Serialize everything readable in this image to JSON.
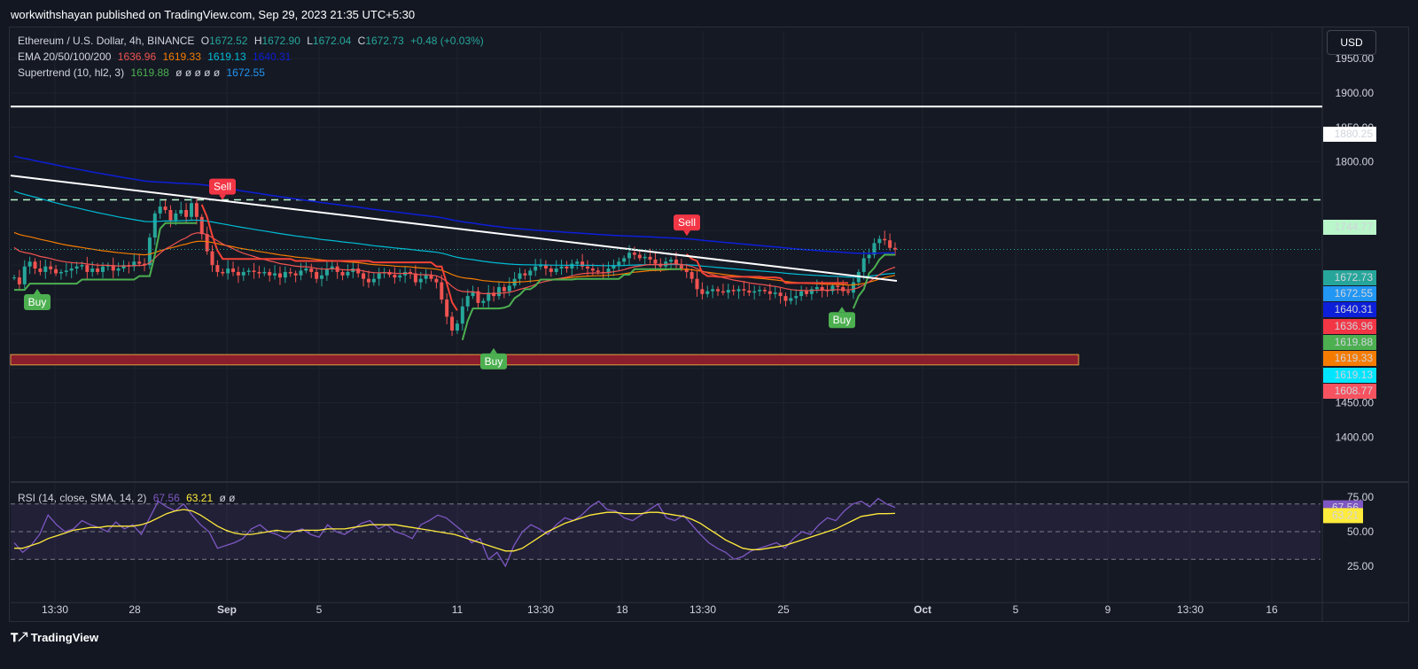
{
  "header": {
    "published": "workwithshayan published on TradingView.com, Sep 29, 2023 21:35 UTC+5:30"
  },
  "legend": {
    "symbol": "Ethereum / U.S. Dollar, 4h, BINANCE",
    "open_label": "O",
    "open": "1672.52",
    "high_label": "H",
    "high": "1672.90",
    "low_label": "L",
    "low": "1672.04",
    "close_label": "C",
    "close": "1672.73",
    "change": "+0.48 (+0.03%)",
    "ema_label": "EMA 20/50/100/200",
    "ema20": "1636.96",
    "ema50": "1619.33",
    "ema100": "1619.13",
    "ema200": "1640.31",
    "supertrend_label": "Supertrend (10, hl2, 3)",
    "st_value": "1619.88",
    "st_empty": "ø ø ø ø ø",
    "st_value2": "1672.55",
    "rsi_label": "RSI (14, close, SMA, 14, 2)",
    "rsi_value": "67.56",
    "rsi_ma": "63.21",
    "rsi_empty": "ø ø"
  },
  "currency_button": "USD",
  "footer": {
    "brand": "TradingView"
  },
  "colors": {
    "up": "#26a69a",
    "down": "#ef5350",
    "ema20": "#ef5350",
    "ema50": "#f57c00",
    "ema100": "#00bcd4",
    "ema200": "#0d1fd8",
    "supertrend_up": "#4caf50",
    "supertrend_down": "#f44336",
    "rsi": "#7e57c2",
    "rsi_ma": "#ffeb3b"
  },
  "chart_data": [
    {
      "type": "candlestick",
      "name": "ETHUSD 4h",
      "x_ticks": [
        "13:30",
        "28",
        "Sep",
        "5",
        "11",
        "13:30",
        "18",
        "13:30",
        "25",
        "Oct",
        "5",
        "9",
        "13:30",
        "16"
      ],
      "y_ticks": [
        "1950.00",
        "1900.00",
        "1850.00",
        "1800.00",
        "1700.00",
        "1450.00",
        "1400.00"
      ],
      "ylim": [
        1370,
        1990
      ],
      "close_path": [
        1632,
        1622,
        1648,
        1655,
        1645,
        1640,
        1648,
        1644,
        1638,
        1640,
        1642,
        1645,
        1648,
        1650,
        1640,
        1645,
        1640,
        1648,
        1650,
        1642,
        1645,
        1650,
        1648,
        1655,
        1652,
        1650,
        1690,
        1725,
        1735,
        1730,
        1715,
        1725,
        1730,
        1720,
        1740,
        1720,
        1695,
        1670,
        1650,
        1640,
        1638,
        1645,
        1640,
        1635,
        1640,
        1642,
        1640,
        1638,
        1640,
        1635,
        1638,
        1632,
        1640,
        1638,
        1635,
        1642,
        1645,
        1640,
        1630,
        1635,
        1645,
        1648,
        1640,
        1635,
        1640,
        1645,
        1638,
        1630,
        1625,
        1630,
        1638,
        1640,
        1636,
        1632,
        1635,
        1640,
        1638,
        1625,
        1630,
        1636,
        1630,
        1625,
        1600,
        1575,
        1555,
        1565,
        1590,
        1605,
        1612,
        1595,
        1598,
        1610,
        1605,
        1618,
        1612,
        1620,
        1630,
        1638,
        1635,
        1642,
        1648,
        1650,
        1645,
        1640,
        1645,
        1648,
        1645,
        1652,
        1655,
        1648,
        1645,
        1642,
        1640,
        1638,
        1645,
        1650,
        1655,
        1660,
        1668,
        1665,
        1660,
        1662,
        1658,
        1652,
        1648,
        1655,
        1658,
        1650,
        1645,
        1640,
        1630,
        1615,
        1608,
        1612,
        1615,
        1612,
        1610,
        1614,
        1612,
        1615,
        1613,
        1610,
        1612,
        1614,
        1612,
        1608,
        1610,
        1605,
        1598,
        1602,
        1605,
        1612,
        1608,
        1615,
        1618,
        1614,
        1612,
        1620,
        1618,
        1612,
        1610,
        1625,
        1640,
        1660,
        1665,
        1682,
        1688,
        1686,
        1675,
        1672.73
      ],
      "horizontal_levels": [
        {
          "price": "1880.25",
          "style": "solid",
          "color": "#ffffff"
        },
        {
          "price": "1744.77",
          "style": "dashed",
          "color": "#b9f6ca"
        }
      ],
      "support_zone": {
        "from": 1505,
        "to": 1520,
        "color": "#8b1e2d"
      },
      "trendline": {
        "from_price": 1780,
        "to_price": 1627,
        "color": "#ffffff"
      },
      "signals": [
        {
          "label": "Buy",
          "type": "buy",
          "price": 1618
        },
        {
          "label": "Sell",
          "type": "sell",
          "price": 1742
        },
        {
          "label": "Buy",
          "type": "buy",
          "price": 1532
        },
        {
          "label": "Sell",
          "type": "sell",
          "price": 1690
        },
        {
          "label": "Buy",
          "type": "buy",
          "price": 1592
        }
      ],
      "price_labels": [
        {
          "value": "1880.25",
          "bg": "#ffffff",
          "fg": "#131722"
        },
        {
          "value": "1744.77",
          "bg": "#b9f6ca",
          "fg": "#131722"
        },
        {
          "value": "1672.73",
          "bg": "#26a69a",
          "fg": "#ffffff"
        },
        {
          "value": "1672.55",
          "bg": "#2196f3",
          "fg": "#ffffff"
        },
        {
          "value": "1640.31",
          "bg": "#0d1fd8",
          "fg": "#ffffff"
        },
        {
          "value": "1636.96",
          "bg": "#f23645",
          "fg": "#ffffff"
        },
        {
          "value": "1619.88",
          "bg": "#4caf50",
          "fg": "#ffffff"
        },
        {
          "value": "1619.33",
          "bg": "#f57c00",
          "fg": "#ffffff"
        },
        {
          "value": "1619.13",
          "bg": "#00e5ff",
          "fg": "#131722"
        },
        {
          "value": "1608.77",
          "bg": "#f7525f",
          "fg": "#ffffff"
        }
      ]
    },
    {
      "type": "line",
      "name": "RSI",
      "y_ticks": [
        "75.00",
        "50.00",
        "25.00"
      ],
      "ylim": [
        20,
        80
      ],
      "bands": [
        30,
        50,
        70
      ],
      "rsi_path": [
        42,
        35,
        40,
        48,
        62,
        55,
        50,
        52,
        58,
        55,
        53,
        50,
        57,
        52,
        55,
        48,
        60,
        72,
        68,
        65,
        70,
        62,
        55,
        50,
        38,
        40,
        42,
        45,
        52,
        55,
        50,
        48,
        45,
        50,
        52,
        48,
        46,
        55,
        50,
        48,
        52,
        56,
        58,
        52,
        55,
        50,
        48,
        45,
        55,
        58,
        62,
        60,
        55,
        50,
        42,
        45,
        30,
        35,
        25,
        40,
        50,
        55,
        52,
        48,
        55,
        60,
        58,
        62,
        68,
        72,
        66,
        65,
        60,
        58,
        62,
        66,
        70,
        60,
        58,
        62,
        55,
        48,
        42,
        38,
        35,
        30,
        32,
        36,
        38,
        40,
        42,
        38,
        45,
        50,
        48,
        55,
        60,
        58,
        65,
        70,
        72,
        68,
        74,
        70,
        67.56
      ],
      "ma_path": [
        38,
        38,
        40,
        42,
        45,
        47,
        49,
        51,
        52,
        53,
        53,
        54,
        54,
        54,
        54,
        55,
        57,
        60,
        63,
        65,
        66,
        65,
        62,
        58,
        54,
        51,
        49,
        48,
        48,
        49,
        50,
        51,
        50,
        50,
        51,
        51,
        51,
        52,
        52,
        52,
        53,
        54,
        55,
        55,
        55,
        55,
        54,
        53,
        52,
        51,
        50,
        49,
        48,
        46,
        44,
        42,
        40,
        38,
        36,
        36,
        38,
        42,
        46,
        50,
        53,
        56,
        58,
        60,
        62,
        63,
        64,
        64,
        63,
        63,
        63,
        64,
        64,
        63,
        62,
        61,
        59,
        56,
        52,
        48,
        44,
        41,
        38,
        37,
        37,
        38,
        39,
        40,
        42,
        44,
        46,
        48,
        50,
        52,
        55,
        58,
        61,
        62,
        63,
        63,
        63.21
      ],
      "labels": [
        {
          "value": "67.56",
          "bg": "#7e57c2",
          "fg": "#ffffff"
        },
        {
          "value": "63.21",
          "bg": "#ffeb3b",
          "fg": "#131722"
        }
      ]
    }
  ]
}
